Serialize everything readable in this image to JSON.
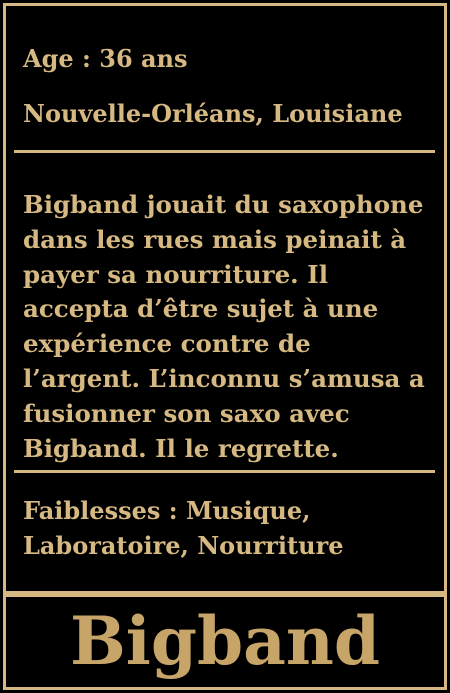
{
  "card": {
    "age": "Age : 36 ans",
    "location": "Nouvelle-Orléans, Louisiane",
    "bio": "Bigband jouait du saxophone dans les rues mais peinait à payer sa nourriture. Il accepta d’être sujet à une expérience contre de l’argent. L’inconnu s’amusa a fusionner son saxo avec Bigband. Il le regrette.",
    "weaknesses": "Faiblesses :  Musique, Laboratoire, Nourriture",
    "name": "Bigband"
  },
  "colors": {
    "background": "#000000",
    "gold": "#d6b982",
    "title_gold": "#c7a468"
  }
}
